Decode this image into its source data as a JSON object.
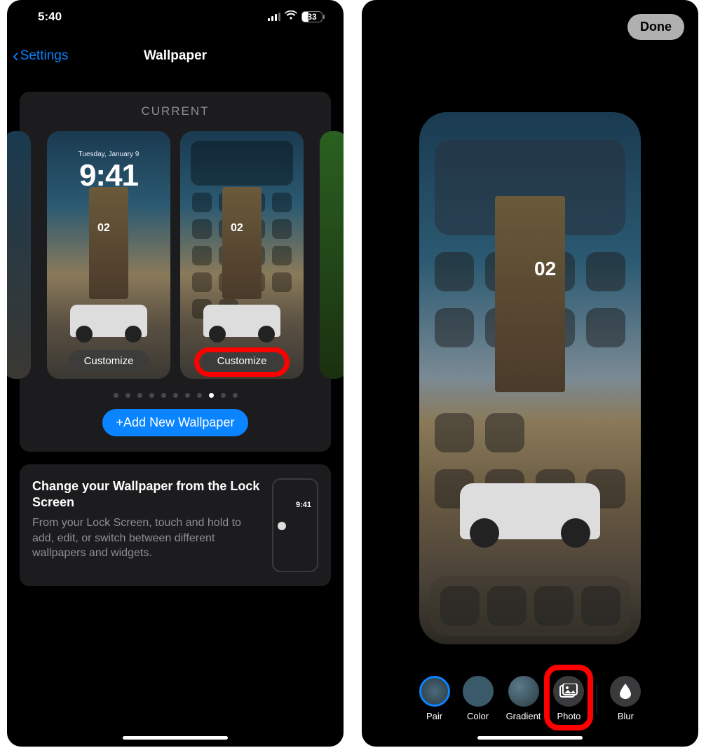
{
  "left": {
    "status": {
      "time": "5:40",
      "battery_pct": "33"
    },
    "nav": {
      "back_label": "Settings",
      "title": "Wallpaper"
    },
    "current_label": "CURRENT",
    "lockscreen_preview": {
      "date": "Tuesday, January 9",
      "time": "9:41",
      "building_label": "02",
      "customize": "Customize"
    },
    "homescreen_preview": {
      "customize": "Customize"
    },
    "page_dots": {
      "count": 11,
      "active_index": 8
    },
    "add_button": "+Add New Wallpaper",
    "tip": {
      "title": "Change your Wallpaper from the Lock Screen",
      "body": "From your Lock Screen, touch and hold to add, edit, or switch between different wallpapers and widgets.",
      "thumb_time": "9:41"
    }
  },
  "right": {
    "done": "Done",
    "building_label": "02",
    "options": {
      "pair": "Pair",
      "color": "Color",
      "gradient": "Gradient",
      "photo": "Photo",
      "blur": "Blur"
    }
  },
  "colors": {
    "ios_blue": "#0a84ff",
    "highlight_red": "#ff0000"
  }
}
